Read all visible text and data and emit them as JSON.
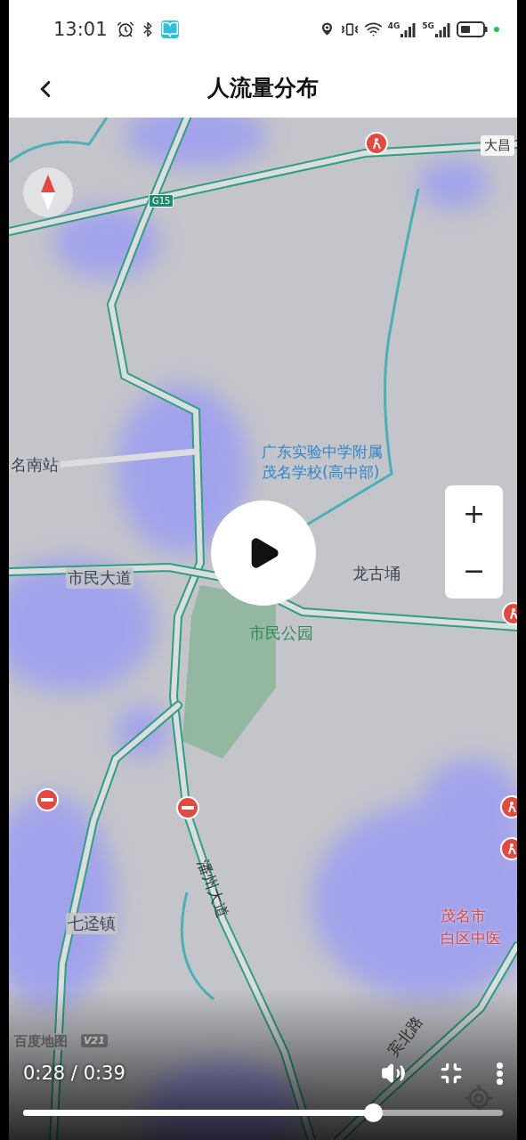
{
  "status_bar": {
    "time": "13:01",
    "networks": [
      "4G",
      "5G"
    ]
  },
  "header": {
    "title": "人流量分布"
  },
  "map": {
    "labels": [
      {
        "text": "大昌",
        "kind": "sign"
      },
      {
        "text": "G15",
        "kind": "shield"
      },
      {
        "text": "名南站",
        "kind": "place"
      },
      {
        "text": "广东实验中学附属",
        "kind": "school"
      },
      {
        "text": "茂名学校(高中部)",
        "kind": "school"
      },
      {
        "text": "市民大道",
        "kind": "place"
      },
      {
        "text": "龙古埇",
        "kind": "place"
      },
      {
        "text": "市民公园",
        "kind": "park"
      },
      {
        "text": "潘州大道",
        "kind": "road"
      },
      {
        "text": "七迳镇",
        "kind": "place"
      },
      {
        "text": "茂名市",
        "kind": "hospital"
      },
      {
        "text": "白区中医",
        "kind": "hospital"
      },
      {
        "text": "宾北路",
        "kind": "road"
      },
      {
        "text": "百度地图",
        "kind": "brand"
      }
    ],
    "brand_version": "V21",
    "zoom": {
      "zoom_in": "+",
      "zoom_out": "−"
    },
    "markers": [
      {
        "kind": "construction"
      },
      {
        "kind": "closed"
      },
      {
        "kind": "closed"
      },
      {
        "kind": "construction"
      },
      {
        "kind": "construction"
      },
      {
        "kind": "construction"
      }
    ]
  },
  "player": {
    "elapsed": "0:28",
    "separator": "/",
    "duration": "0:39",
    "level": 0.73
  }
}
